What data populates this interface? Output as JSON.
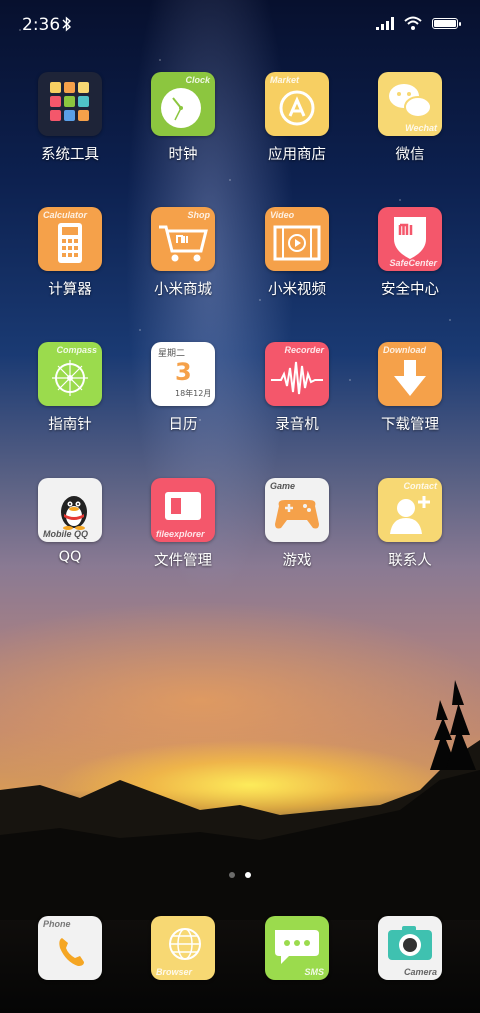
{
  "status_bar": {
    "time": "2:36",
    "battery_level": 0.9
  },
  "pages": {
    "count": 2,
    "active": 2
  },
  "grid": [
    {
      "label": "系统工具",
      "icon": "folder-icon",
      "color": "#1e2438"
    },
    {
      "label": "时钟",
      "icon": "clock-icon",
      "color": "#8cc63f",
      "en": "Clock"
    },
    {
      "label": "应用商店",
      "icon": "app-store-icon",
      "color": "#f7cf62",
      "en": "Market"
    },
    {
      "label": "微信",
      "icon": "wechat-icon",
      "color": "#f7d873",
      "en": "Wechat"
    },
    {
      "label": "计算器",
      "icon": "calculator-icon",
      "color": "#f5a14a",
      "en": "Calculator"
    },
    {
      "label": "小米商城",
      "icon": "shopping-cart-icon",
      "color": "#f5a14a",
      "en": "Shop"
    },
    {
      "label": "小米视频",
      "icon": "video-icon",
      "color": "#f5a14a",
      "en": "Video"
    },
    {
      "label": "安全中心",
      "icon": "shield-icon",
      "color": "#f4576b",
      "en": "SafeCenter"
    },
    {
      "label": "指南针",
      "icon": "compass-icon",
      "color": "#9bdb4d",
      "en": "Compass"
    },
    {
      "label": "日历",
      "icon": "calendar-icon",
      "color": "#ffffff"
    },
    {
      "label": "录音机",
      "icon": "recorder-icon",
      "color": "#f4576b",
      "en": "Recorder"
    },
    {
      "label": "下载管理",
      "icon": "download-icon",
      "color": "#f5a14a",
      "en": "Download"
    },
    {
      "label": "QQ",
      "icon": "qq-penguin-icon",
      "color": "#f2f2f2",
      "en": "Mobile QQ"
    },
    {
      "label": "文件管理",
      "icon": "file-manager-icon",
      "color": "#f4576b",
      "en": "fileexplorer"
    },
    {
      "label": "游戏",
      "icon": "gamepad-icon",
      "color": "#f2f2f2",
      "en": "Game"
    },
    {
      "label": "联系人",
      "icon": "contact-icon",
      "color": "#f7d873",
      "en": "Contact"
    }
  ],
  "calendar_icon": {
    "weekday": "星期二",
    "day": "3",
    "month": "18年12月"
  },
  "dock": [
    {
      "icon": "phone-icon",
      "color": "#f2f2f2",
      "en": "Phone"
    },
    {
      "icon": "browser-icon",
      "color": "#f7d873",
      "en": "Browser"
    },
    {
      "icon": "sms-icon",
      "color": "#9bdb4d",
      "en": "SMS"
    },
    {
      "icon": "camera-icon",
      "color": "#f2f2f2",
      "en": "Camera"
    }
  ]
}
